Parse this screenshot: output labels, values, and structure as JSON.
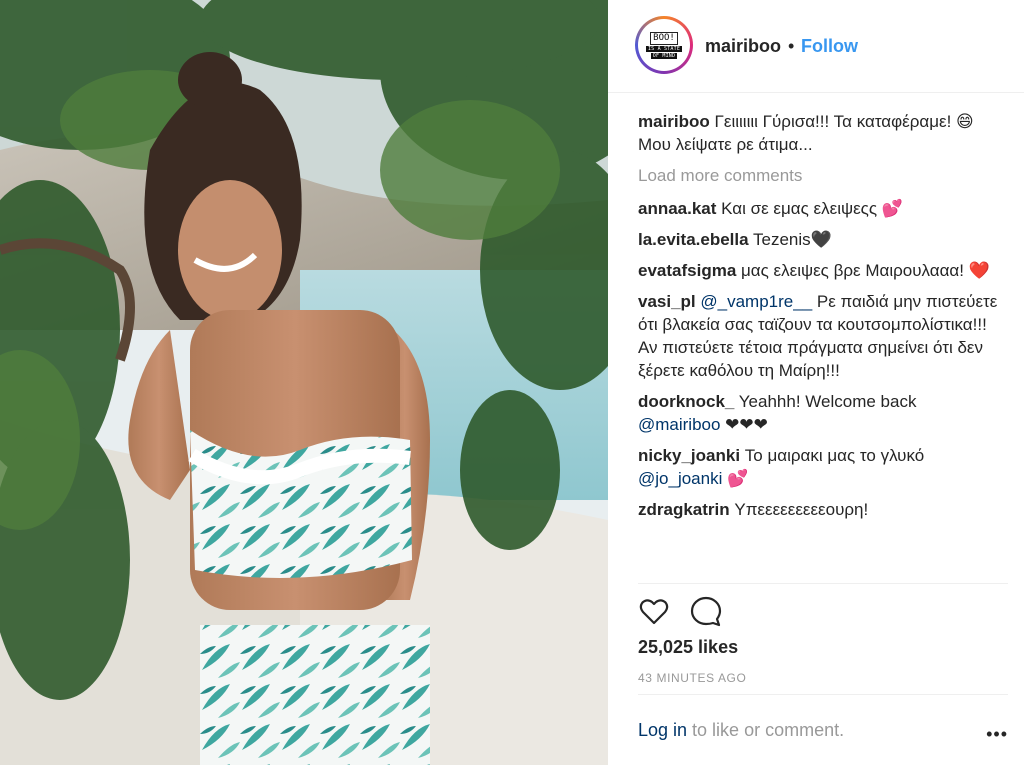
{
  "post": {
    "username": "mairiboo",
    "header_separator": "•",
    "follow_label": "Follow",
    "avatar_text_top": "BOO!",
    "avatar_text_lines": [
      "IS A STATE",
      "OF MIND"
    ],
    "caption": {
      "user": "mairiboo",
      "text": " Γειιιιιιι Γύρισα!!! Τα καταφέραμε! 😄",
      "text2": "Μου λείψατε ρε άτιμα..."
    },
    "load_more": "Load more comments",
    "comments": [
      {
        "user": "annaa.kat",
        "pre": " Και σε εμας ελειψεςς 💕",
        "mention": "",
        "post": ""
      },
      {
        "user": "la.evita.ebella",
        "pre": " Tezenis🖤",
        "mention": "",
        "post": ""
      },
      {
        "user": "evatafsigma",
        "pre": " μας ελειψες βρε Μαιρουλααα! ❤️",
        "mention": "",
        "post": ""
      },
      {
        "user": "vasi_pl",
        "pre": " ",
        "mention": "@_vamp1re__",
        "post": " Ρε παιδιά μην πιστεύετε ότι βλακεία σας ταϊζουν τα κουτσομπολίστικα!!! Αν πιστεύετε τέτοια πράγματα σημείνει ότι δεν ξέρετε καθόλου τη Μαίρη!!!"
      },
      {
        "user": "doorknock_",
        "pre": " Yeahhh! Welcome back ",
        "mention": "@mairiboo",
        "post": " ❤❤❤"
      },
      {
        "user": "nicky_joanki",
        "pre": " Το μαιρακι μας το γλυκό ",
        "mention": "@jo_joanki",
        "post": " 💕"
      }
    ],
    "cut_comment": {
      "user": "zdragkatrin",
      "text": " Υπεεεεεεεεεουρη!"
    },
    "likes": "25,025 likes",
    "time": "43 MINUTES AGO",
    "login_link": "Log in",
    "login_rest": " to like or comment.",
    "more_dots": "•••",
    "icons": {
      "like": "heart-outline-icon",
      "comment": "comment-bubble-icon",
      "more": "more-dots-icon"
    },
    "colors": {
      "link": "#3897f0",
      "mention": "#003569",
      "muted": "#999999",
      "text": "#262626"
    }
  }
}
